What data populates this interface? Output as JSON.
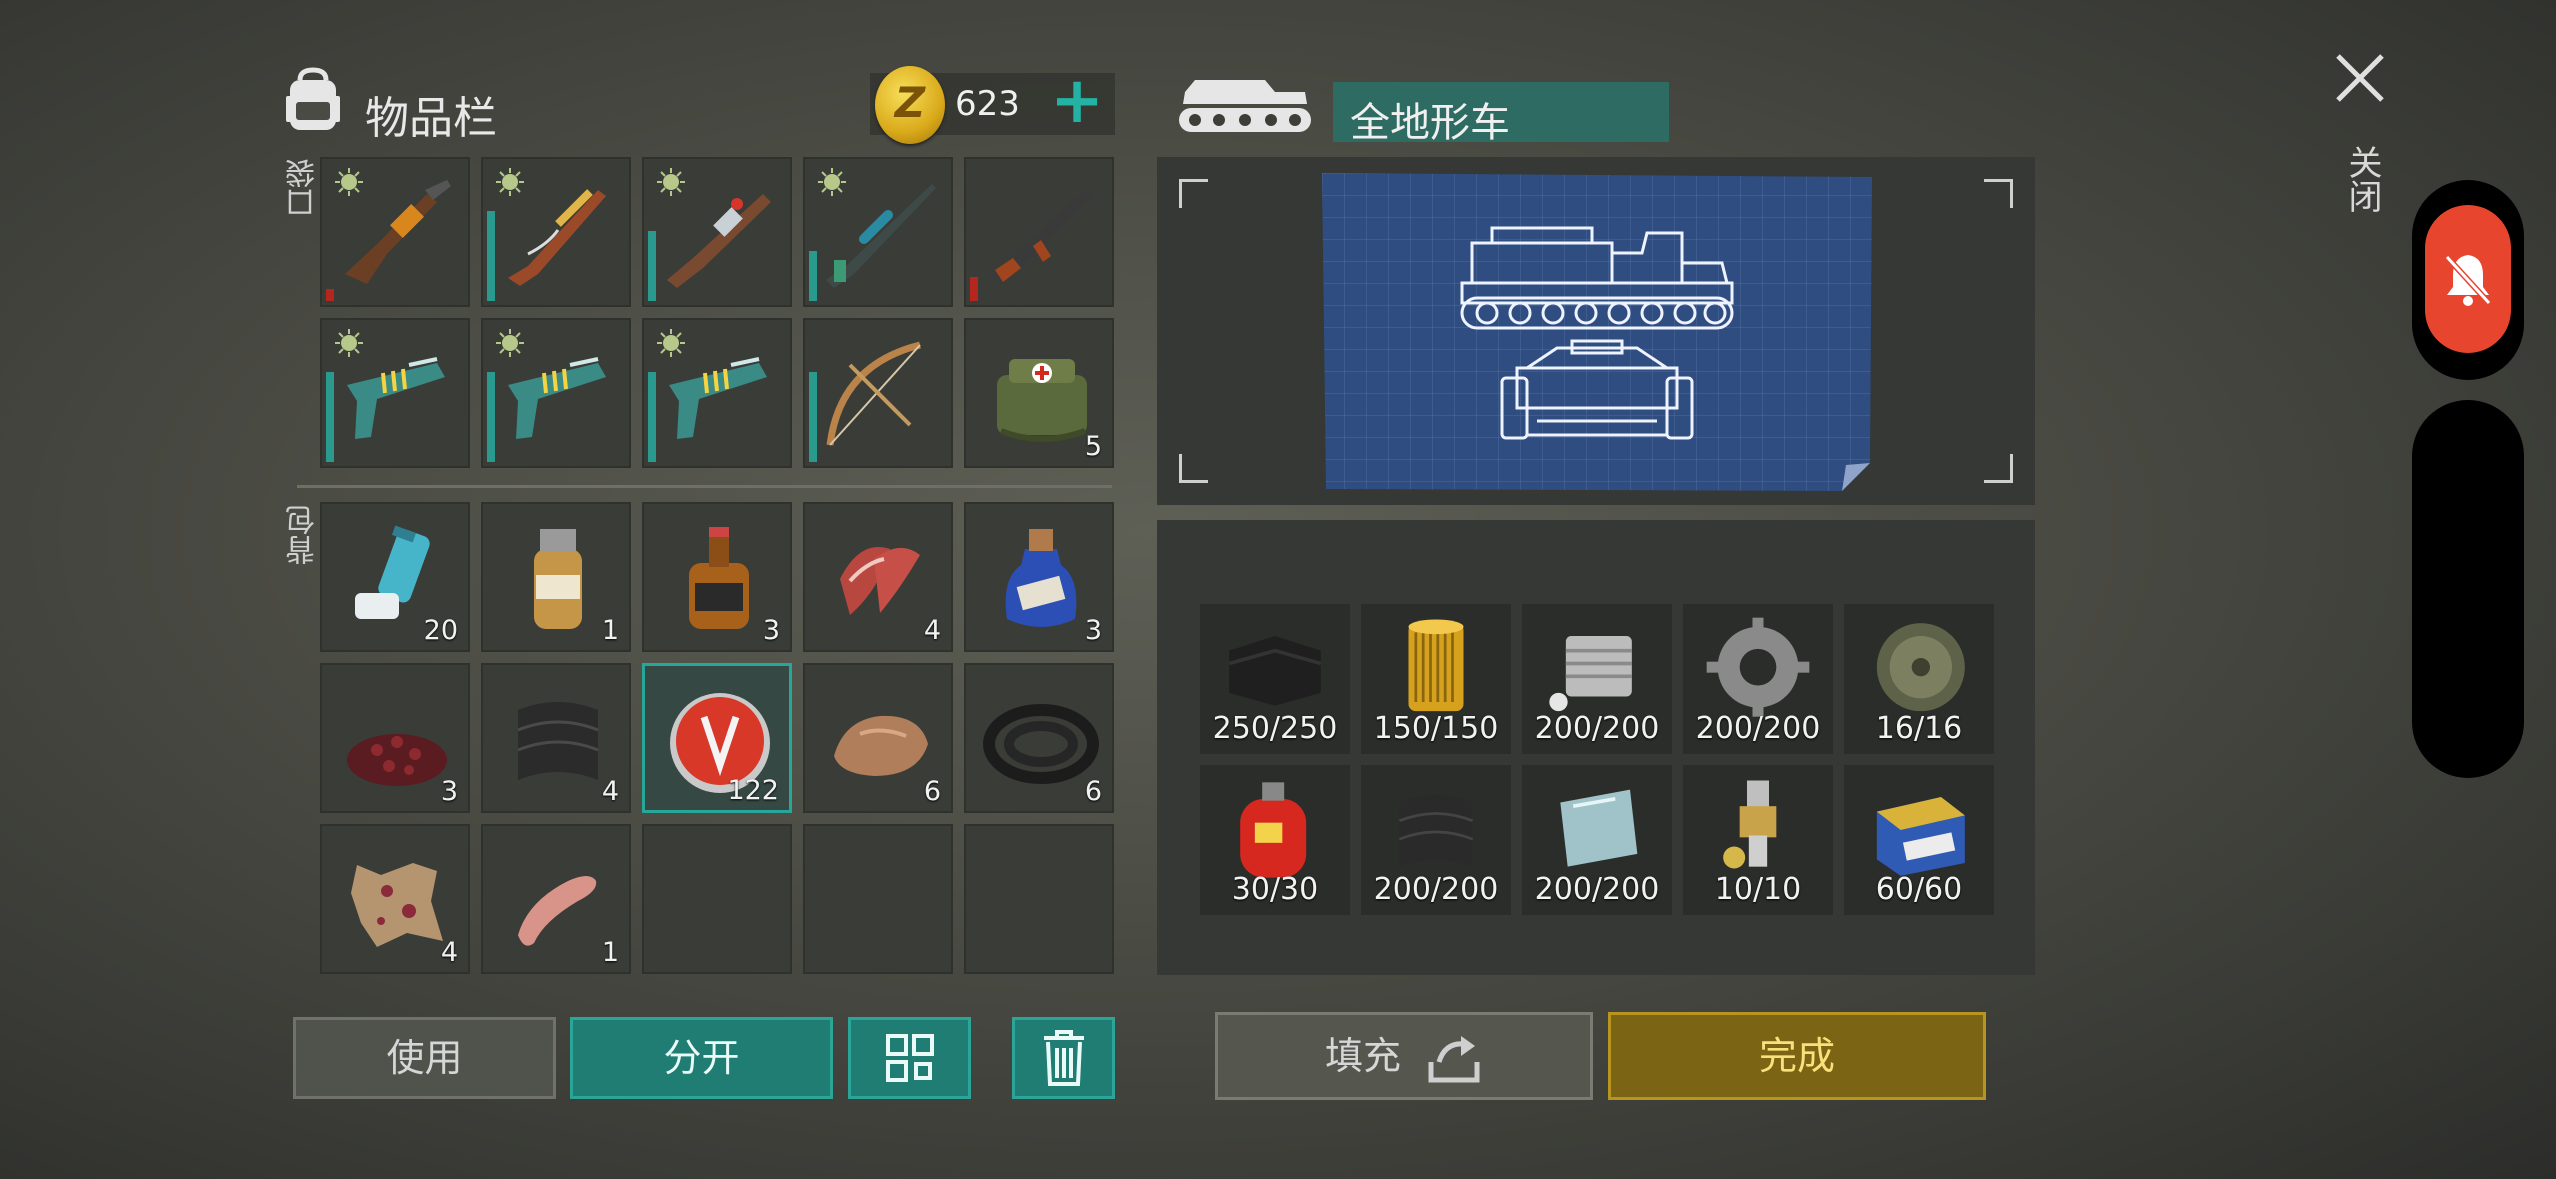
{
  "header": {
    "title": "物品栏",
    "coin_symbol": "Z",
    "coins": "623",
    "add_label": "+"
  },
  "sections": {
    "pockets": "口袋",
    "backpack": "背包"
  },
  "pocket_slots": [
    {
      "icon": "grenade-launcher-icon",
      "count": "",
      "badge": true
    },
    {
      "icon": "ornate-shotgun-icon",
      "count": "",
      "badge": true
    },
    {
      "icon": "crafted-rifle-icon",
      "count": "",
      "badge": true
    },
    {
      "icon": "sniper-rifle-icon",
      "count": "",
      "badge": true
    },
    {
      "icon": "assault-rifle-icon",
      "count": "",
      "badge": false
    },
    {
      "icon": "energy-pistol-icon",
      "count": "",
      "badge": true
    },
    {
      "icon": "energy-pistol-icon",
      "count": "",
      "badge": true
    },
    {
      "icon": "energy-pistol-icon",
      "count": "",
      "badge": true
    },
    {
      "icon": "crossbow-icon",
      "count": "",
      "badge": false
    },
    {
      "icon": "medkit-bag-icon",
      "count": "5",
      "badge": false
    }
  ],
  "backpack_slots": [
    {
      "icon": "inhaler-icon",
      "count": "20"
    },
    {
      "icon": "pill-bottle-icon",
      "count": "1"
    },
    {
      "icon": "whiskey-bottle-icon",
      "count": "3"
    },
    {
      "icon": "raw-meat-icon",
      "count": "4"
    },
    {
      "icon": "blue-potion-icon",
      "count": "3"
    },
    {
      "icon": "berries-pile-icon",
      "count": "3"
    },
    {
      "icon": "fabric-sheet-icon",
      "count": "4"
    },
    {
      "icon": "bottle-cap-icon",
      "count": "122"
    },
    {
      "icon": "rock-icon",
      "count": "6"
    },
    {
      "icon": "rubber-hose-icon",
      "count": "6"
    },
    {
      "icon": "animal-hide-icon",
      "count": "4"
    },
    {
      "icon": "sausage-icon",
      "count": "1"
    },
    {
      "icon": "",
      "count": ""
    },
    {
      "icon": "",
      "count": ""
    },
    {
      "icon": "",
      "count": ""
    }
  ],
  "vehicle": {
    "name": "全地形车"
  },
  "materials": [
    {
      "icon": "leather-sheet-icon",
      "count": "250/250"
    },
    {
      "icon": "air-filter-icon",
      "count": "150/150"
    },
    {
      "icon": "engine-cylinder-icon",
      "count": "200/200"
    },
    {
      "icon": "gear-icon",
      "count": "200/200"
    },
    {
      "icon": "tire-icon",
      "count": "16/16"
    },
    {
      "icon": "gas-canister-icon",
      "count": "30/30"
    },
    {
      "icon": "carbon-fabric-icon",
      "count": "200/200"
    },
    {
      "icon": "glass-pane-icon",
      "count": "200/200"
    },
    {
      "icon": "spark-plug-icon",
      "count": "10/10"
    },
    {
      "icon": "car-battery-icon",
      "count": "60/60"
    }
  ],
  "buttons": {
    "use": "使用",
    "split": "分开",
    "fill": "填充",
    "done": "完成"
  },
  "close_label": "关闭",
  "colors": {
    "accent": "#1f7d73",
    "done": "#7b6514",
    "coin": "#e0b020",
    "notification": "#e8452f"
  }
}
